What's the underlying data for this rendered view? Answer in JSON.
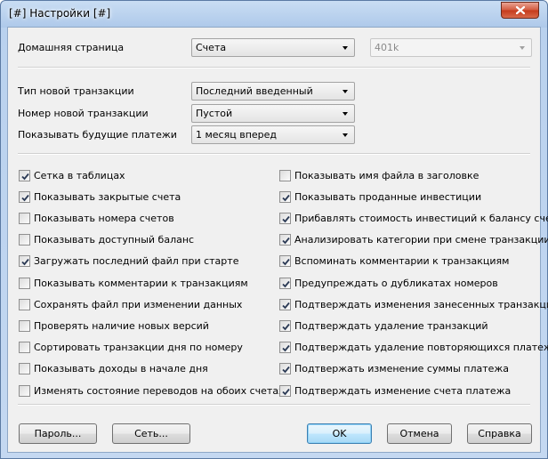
{
  "window": {
    "title": "[#] Настройки [#]"
  },
  "general": {
    "home_page_label": "Домашняя страница",
    "home_page_value": "Счета",
    "home_page_sub_value": "401k",
    "new_tx_type_label": "Тип новой транзакции",
    "new_tx_type_value": "Последний введенный",
    "new_tx_number_label": "Номер новой транзакции",
    "new_tx_number_value": "Пустой",
    "future_payments_label": "Показывать будущие платежи",
    "future_payments_value": "1 месяц вперед"
  },
  "options_left": [
    {
      "label": "Сетка в таблицах",
      "checked": true
    },
    {
      "label": "Показывать закрытые счета",
      "checked": true
    },
    {
      "label": "Показывать номера счетов",
      "checked": false
    },
    {
      "label": "Показывать доступный баланс",
      "checked": false
    },
    {
      "label": "Загружать последний файл при старте",
      "checked": true
    },
    {
      "label": "Показывать комментарии к транзакциям",
      "checked": false
    },
    {
      "label": "Сохранять файл при изменении данных",
      "checked": false
    },
    {
      "label": "Проверять наличие новых версий",
      "checked": false
    },
    {
      "label": "Сортировать транзакции дня по номеру",
      "checked": false
    },
    {
      "label": "Показывать доходы в начале дня",
      "checked": false
    },
    {
      "label": "Изменять состояние переводов на обоих счетах",
      "checked": false
    }
  ],
  "options_right": [
    {
      "label": "Показывать имя файла в заголовке",
      "checked": false
    },
    {
      "label": "Показывать проданные инвестиции",
      "checked": true
    },
    {
      "label": "Прибавлять стоимость инвестиций к балансу счета",
      "checked": true
    },
    {
      "label": "Анализировать категории при смене транзакции",
      "checked": true
    },
    {
      "label": "Вспоминать комментарии к транзакциям",
      "checked": true
    },
    {
      "label": "Предупреждать о дубликатах номеров",
      "checked": true
    },
    {
      "label": "Подтверждать изменения занесенных транзакций",
      "checked": true
    },
    {
      "label": "Подтверждать удаление транзакций",
      "checked": true
    },
    {
      "label": "Подтверждать удаление повторяющихся платежей",
      "checked": true
    },
    {
      "label": "Подтвержать изменение суммы платежа",
      "checked": true
    },
    {
      "label": "Подтверждать изменение счета платежа",
      "checked": true
    }
  ],
  "buttons": {
    "password": "Пароль...",
    "network": "Сеть...",
    "ok": "OK",
    "cancel": "Отмена",
    "help": "Справка"
  },
  "icons": {
    "close": "close-icon",
    "dropdown": "chevron-down-icon",
    "check": "check-icon"
  }
}
